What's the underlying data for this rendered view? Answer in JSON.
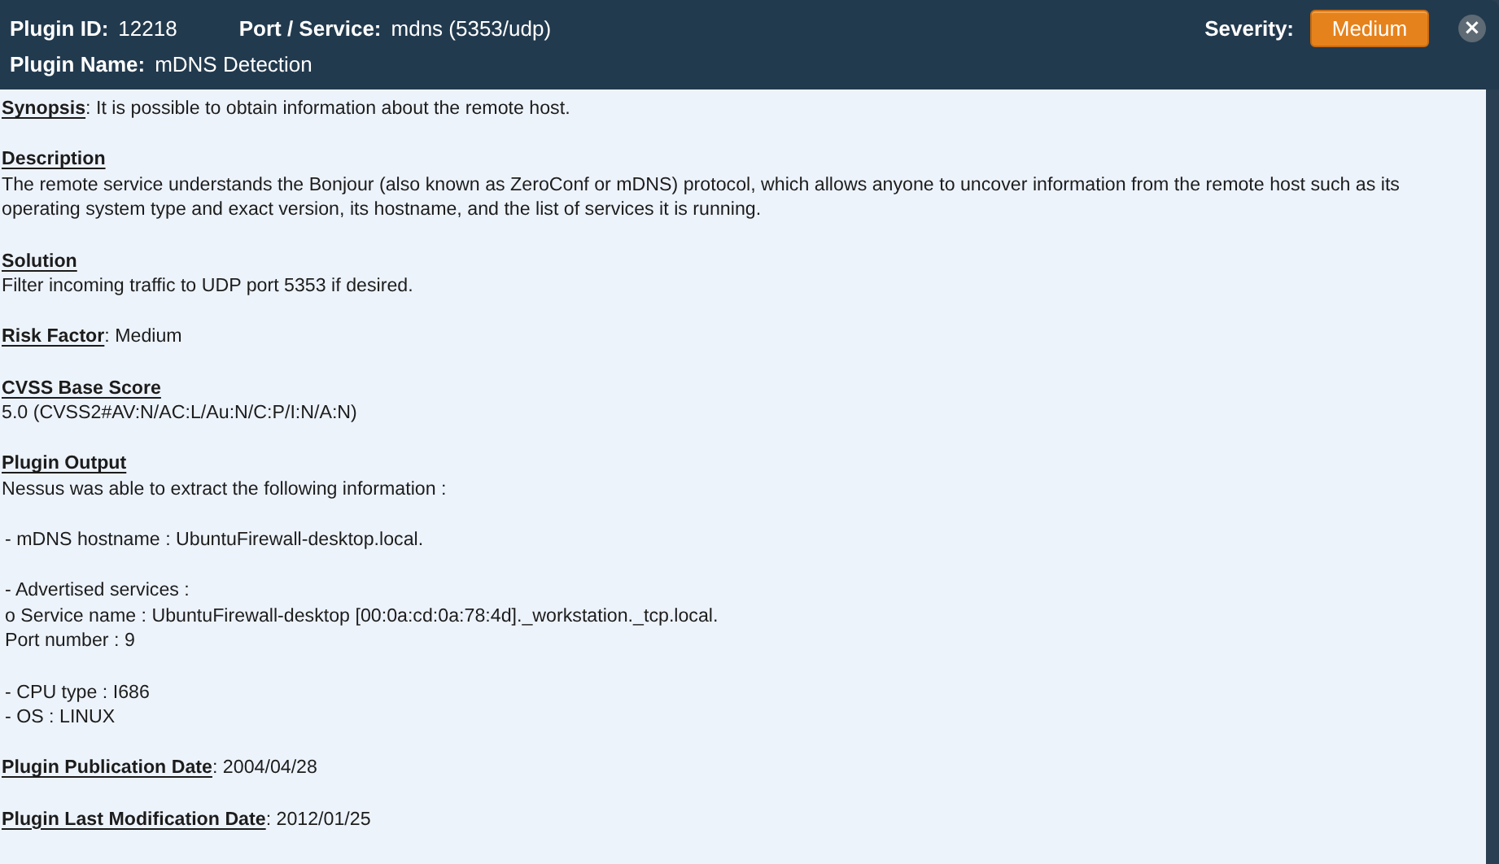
{
  "header": {
    "plugin_id_label": "Plugin ID:",
    "plugin_id": "12218",
    "port_label": "Port / Service:",
    "port": "mdns (5353/udp)",
    "plugin_name_label": "Plugin Name:",
    "plugin_name": "mDNS Detection",
    "severity_label": "Severity:",
    "severity": "Medium",
    "close": "×"
  },
  "sections": [
    {
      "kind": "inline",
      "text": "**Synopsis**: It is possible to obtain information about the remote host."
    },
    {
      "kind": "block",
      "heading": "Description",
      "paragraphs": [
        [
          "The remote service understands the Bonjour (also known as ZeroConf or mDNS) protocol, which allows anyone to uncover information from the remote host such as its operating system type and exact version, its hostname, and the list of services it is running."
        ]
      ]
    },
    {
      "kind": "block",
      "heading": "Solution",
      "paragraphs": [
        [
          "Filter incoming traffic to UDP port 5353 if desired."
        ]
      ]
    },
    {
      "kind": "inline",
      "text": "**Risk Factor**: Medium"
    },
    {
      "kind": "block",
      "heading": "CVSS Base Score",
      "paragraphs": [
        [
          "5.0 (CVSS2#AV:N/AC:L/Au:N/C:P/I:N/A:N)"
        ]
      ]
    },
    {
      "kind": "block",
      "heading": "Plugin Output",
      "paragraphs": [
        [
          "Nessus was able to extract the following information :"
        ],
        [
          "- mDNS hostname : UbuntuFirewall-desktop.local."
        ],
        [
          "- Advertised services :",
          "o Service name : UbuntuFirewall-desktop [00:0a:cd:0a:78:4d]._workstation._tcp.local.",
          "Port number : 9"
        ],
        [
          "- CPU type : I686",
          "- OS : LINUX"
        ]
      ]
    },
    {
      "kind": "inline",
      "text": "**Plugin Publication Date**: 2004/04/28"
    },
    {
      "kind": "inline",
      "text": "**Plugin Last Modification Date**: 2012/01/25"
    }
  ]
}
